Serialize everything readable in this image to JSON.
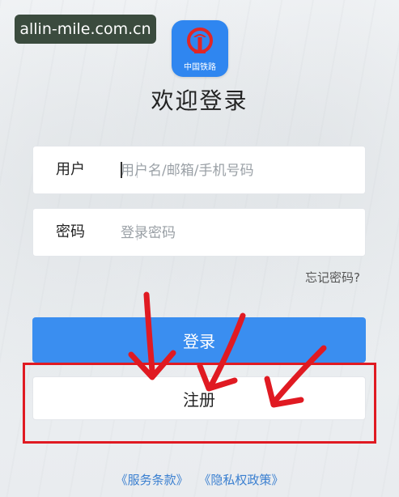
{
  "watermark": "allin-mile.com.cn",
  "app": {
    "logo_text": "中国铁路",
    "brand_color": "#2f86f0"
  },
  "welcome_title": "欢迎登录",
  "form": {
    "username_label": "用户",
    "username_placeholder": "用户名/邮箱/手机号码",
    "password_label": "密码",
    "password_placeholder": "登录密码",
    "forgot_link": "忘记密码?"
  },
  "buttons": {
    "login": "登录",
    "register": "注册"
  },
  "footer": {
    "terms": "《服务条款》",
    "privacy": "《隐私权政策》"
  },
  "annotation": {
    "color": "#e01a22"
  }
}
